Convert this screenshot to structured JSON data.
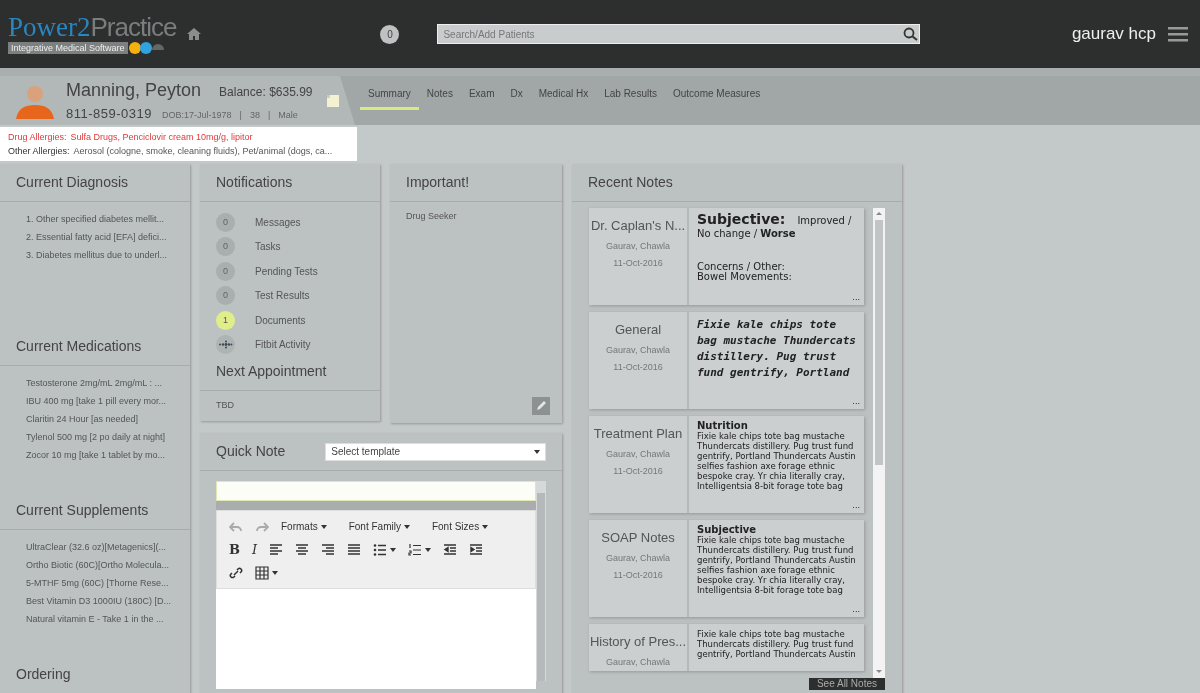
{
  "navbar": {
    "logo": {
      "brand_primary": "Power2",
      "brand_secondary": "Practice",
      "tagline": "Integrative Medical Software"
    },
    "alert_count": "0",
    "search": {
      "placeholder": "Search/Add Patients"
    },
    "user": "gaurav hcp"
  },
  "patient": {
    "name": "Manning, Peyton",
    "balance": "Balance: $635.99",
    "phone": "811-859-0319",
    "details": [
      "DOB:17-Jul-1978",
      "|",
      "38",
      "|",
      "Male"
    ]
  },
  "tabs": [
    {
      "label": "Summary",
      "selected": true
    },
    {
      "label": "Notes",
      "selected": false
    },
    {
      "label": "Exam",
      "selected": false
    },
    {
      "label": "Dx",
      "selected": false
    },
    {
      "label": "Medical Hx",
      "selected": false
    },
    {
      "label": "Lab Results",
      "selected": false
    },
    {
      "label": "Outcome Measures",
      "selected": false
    }
  ],
  "allergies": [
    {
      "kind": "drug",
      "label": "Drug Allergies:",
      "text": "Sulfa Drugs, Penciclovir cream 10mg/g, lipitor"
    },
    {
      "kind": "other",
      "label": "Other Allergies:",
      "text": "Aerosol (cologne, smoke, cleaning fluids), Pet/animal (dogs, ca..."
    }
  ],
  "sidebar": {
    "sections": [
      {
        "title": "Current Diagnosis",
        "items": [
          "1. Other specified diabetes mellit...",
          "2. Essential fatty acid [EFA] defici...",
          "3. Diabetes mellitus due to underl..."
        ]
      },
      {
        "title": "Current Medications",
        "items": [
          "Testosterone 2mg/mL 2mg/mL : ...",
          "IBU 400 mg [take 1 pill every mor...",
          "Claritin 24 Hour [as needed]",
          "Tylenol 500 mg [2 po daily at night]",
          "Zocor 10 mg [take 1 tablet by mo..."
        ]
      },
      {
        "title": "Current Supplements",
        "items": [
          "UltraClear (32.6 oz)[Metagenics](...",
          "Ortho Biotic (60C)[Ortho Molecula...",
          "5-MTHF 5mg (60C) [Thorne Rese...",
          "Best Vitamin D3 1000IU (180C) [D...",
          "Natural vitamin E - Take 1 in the ..."
        ]
      },
      {
        "title": "Ordering"
      }
    ]
  },
  "notifications": {
    "title": "Notifications",
    "items": [
      {
        "kind": "count",
        "count": "0",
        "label": "Messages",
        "highlighted": false
      },
      {
        "kind": "count",
        "count": "0",
        "label": "Tasks",
        "highlighted": false
      },
      {
        "kind": "count",
        "count": "0",
        "label": "Pending Tests",
        "highlighted": false
      },
      {
        "kind": "count",
        "count": "0",
        "label": "Test Results",
        "highlighted": false
      },
      {
        "kind": "count",
        "count": "1",
        "label": "Documents",
        "highlighted": true
      },
      {
        "kind": "fitbit",
        "label": "Fitbit Activity"
      }
    ],
    "next_appointment": {
      "title": "Next Appointment",
      "value": "TBD"
    }
  },
  "important": {
    "title": "Important!",
    "items": [
      "Drug Seeker"
    ]
  },
  "quick_note": {
    "title": "Quick Note",
    "template": {
      "value": "Select template"
    },
    "toolbar": [
      [
        {
          "kind": "undo",
          "disabled": true
        },
        {
          "kind": "redo",
          "disabled": true
        },
        {
          "kind": "menu",
          "label": "Formats",
          "disabled": false
        },
        {
          "kind": "menu",
          "label": "Font Family",
          "disabled": false
        },
        {
          "kind": "menu",
          "label": "Font Sizes",
          "disabled": false
        }
      ],
      [
        {
          "kind": "bold",
          "label": "B",
          "disabled": false
        },
        {
          "kind": "italic",
          "label": "I",
          "disabled": false
        },
        {
          "kind": "align-left",
          "disabled": false
        },
        {
          "kind": "align-center",
          "disabled": false
        },
        {
          "kind": "align-right",
          "disabled": false
        },
        {
          "kind": "justify",
          "disabled": false
        },
        {
          "kind": "bullet-list",
          "disabled": false
        },
        {
          "kind": "number-list",
          "disabled": false
        },
        {
          "kind": "outdent",
          "disabled": false
        },
        {
          "kind": "indent",
          "disabled": false
        }
      ],
      [
        {
          "kind": "link",
          "disabled": false
        },
        {
          "kind": "table",
          "disabled": false
        }
      ]
    ]
  },
  "recent_notes": {
    "title": "Recent Notes",
    "notes": [
      {
        "title": "Dr. Caplan's N...",
        "author": "Gaurav, Chawla",
        "date": "11-Oct-2016",
        "blocks": [
          {
            "kind": "lead",
            "heading": "Subjective:",
            "text": "Improved / No change / **Worse**"
          },
          {
            "kind": "section",
            "text": "Concerns / Other:"
          },
          {
            "kind": "text",
            "text": "Bowel Movements:"
          }
        ],
        "more": "..."
      },
      {
        "title": "General",
        "author": "Gaurav, Chawla",
        "date": "11-Oct-2016",
        "blocks": [
          {
            "kind": "script",
            "text": "Fixie kale chips tote bag mustache Thundercats distillery. Pug trust fund gentrify, Portland"
          }
        ],
        "more": "..."
      },
      {
        "title": "Treatment Plan",
        "author": "Gaurav, Chawla",
        "date": "11-Oct-2016",
        "blocks": [
          {
            "kind": "heading",
            "text": "Nutrition"
          },
          {
            "kind": "text",
            "text": "Fixie kale chips tote bag mustache Thundercats distillery. Pug trust fund gentrify, Portland Thundercats Austin selfies fashion axe forage ethnic bespoke cray. Yr chia literally cray, Intelligentsia 8-bit forage tote bag"
          }
        ],
        "more": "..."
      },
      {
        "title": "SOAP Notes",
        "author": "Gaurav, Chawla",
        "date": "11-Oct-2016",
        "blocks": [
          {
            "kind": "heading",
            "text": "Subjective"
          },
          {
            "kind": "text",
            "text": "Fixie kale chips tote bag mustache Thundercats distillery. Pug trust fund gentrify, Portland Thundercats Austin selfies fashion axe forage ethnic bespoke cray. Yr chia literally cray, Intelligentsia 8-bit forage tote bag"
          }
        ],
        "more": "..."
      },
      {
        "title": "History of Pres...",
        "author": "Gaurav, Chawla",
        "blocks": [
          {
            "kind": "text",
            "text": "Fixie kale chips tote bag mustache Thundercats distillery. Pug trust fund gentrify, Portland Thundercats Austin"
          }
        ]
      }
    ],
    "see_all": "See All Notes"
  }
}
